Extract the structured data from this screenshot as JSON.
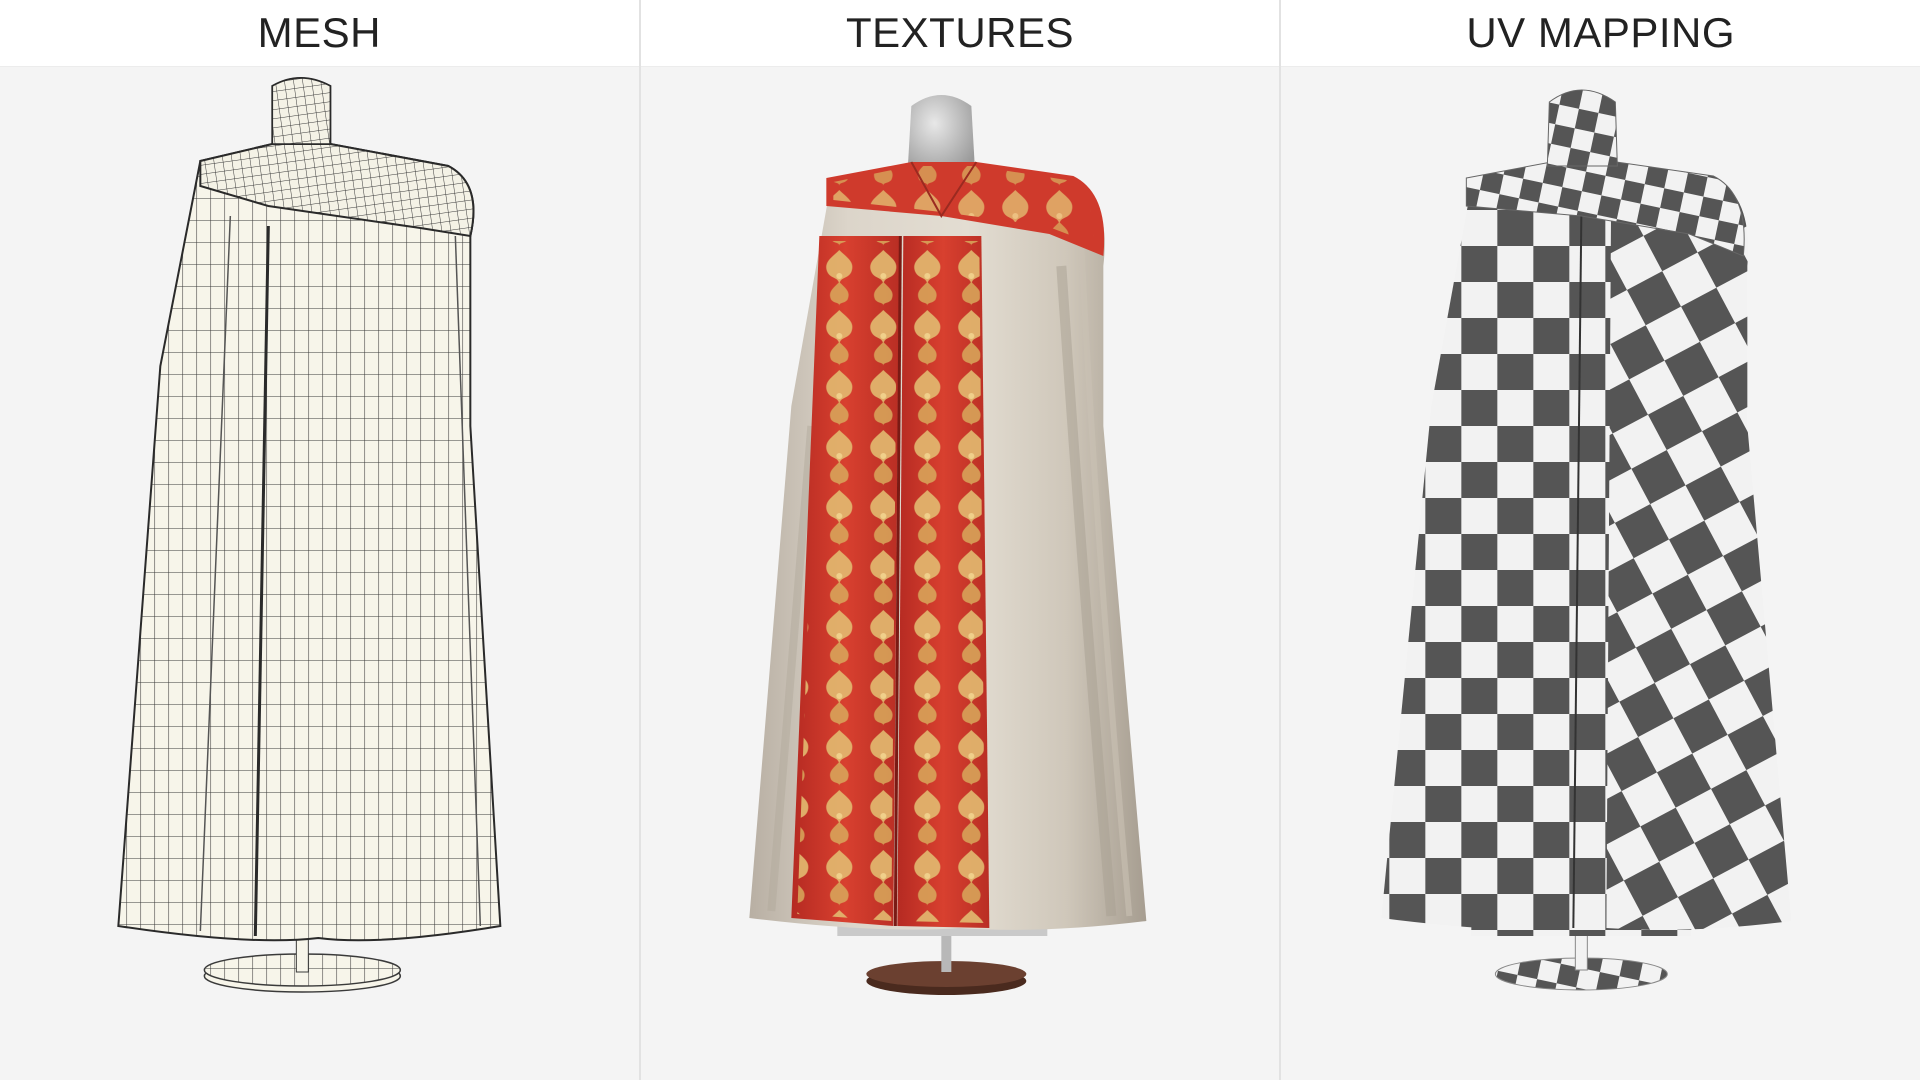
{
  "panels": [
    {
      "title": "MESH",
      "view": "wireframe"
    },
    {
      "title": "TEXTURES",
      "view": "textured"
    },
    {
      "title": "UV MAPPING",
      "view": "checker"
    }
  ],
  "colors": {
    "panel_background": "#f4f4f4",
    "header_background": "#ffffff",
    "title_text": "#222222",
    "mesh_fill": "#f7f5ea",
    "mesh_line": "#3a3a3a",
    "cope_cream": "#d9d1c5",
    "orphrey_red": "#d03a30",
    "embroidery_gold": "#dcb068",
    "checker_dark": "#555555",
    "checker_light": "#f2f2f2",
    "stand_wood": "#6b4030",
    "mannequin_grey": "#c9c9c9"
  },
  "icons": {
    "mesh_view": "wireframe-cope-render",
    "texture_view": "textured-cope-render",
    "uv_view": "checker-cope-render"
  }
}
